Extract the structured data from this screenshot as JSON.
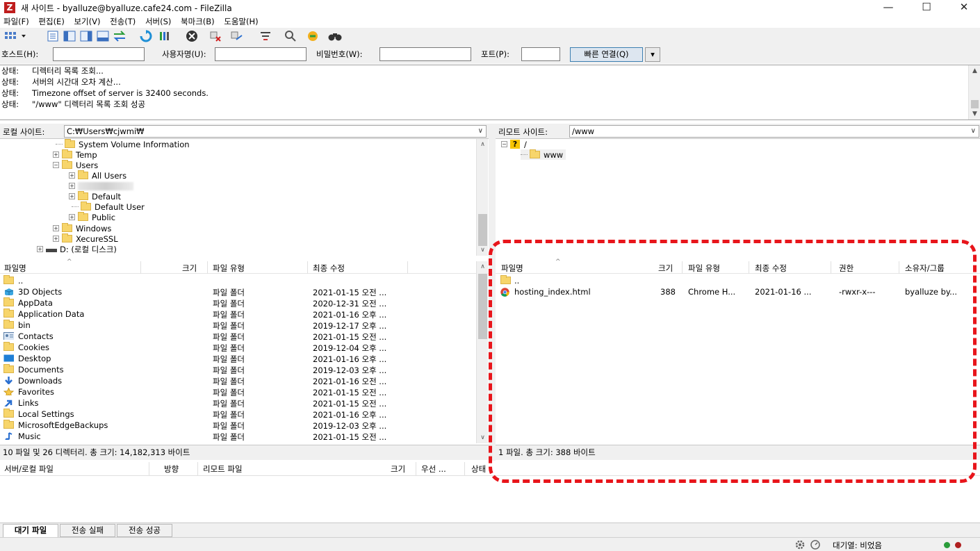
{
  "window": {
    "title": "새 사이트 - byalluze@byalluze.cafe24.com - FileZilla",
    "app_icon_letter": "Z",
    "controls": [
      "—",
      "☐",
      "✕"
    ]
  },
  "menu": [
    "파일(F)",
    "편집(E)",
    "보기(V)",
    "전송(T)",
    "서버(S)",
    "북마크(B)",
    "도움말(H)"
  ],
  "quickconnect": {
    "host_label": "호스트(H):",
    "host_value": "",
    "user_label": "사용자명(U):",
    "user_value": "",
    "pass_label": "비밀번호(W):",
    "pass_value": "",
    "port_label": "포트(P):",
    "port_value": "",
    "connect_label": "빠른 연결(Q)"
  },
  "log": [
    {
      "k": "상태:",
      "v": "디렉터리 목록 조회..."
    },
    {
      "k": "상태:",
      "v": "서버의 시간대 오차 계산..."
    },
    {
      "k": "상태:",
      "v": "Timezone offset of server is 32400 seconds."
    },
    {
      "k": "상태:",
      "v": "\"/www\" 디렉터리 목록 조회 성공"
    }
  ],
  "local": {
    "site_label": "로컬 사이트:",
    "path": "C:₩Users₩cjwmi₩",
    "tree": [
      {
        "label": "System Volume Information",
        "expander": ""
      },
      {
        "label": "Temp",
        "expander": "+"
      },
      {
        "label": "Users",
        "expander": "−"
      },
      {
        "label": "All Users",
        "expander": "+"
      },
      {
        "label": "",
        "expander": "+"
      },
      {
        "label": "Default",
        "expander": "+"
      },
      {
        "label": "Default User",
        "expander": ""
      },
      {
        "label": "Public",
        "expander": "+"
      },
      {
        "label": "Windows",
        "expander": "+"
      },
      {
        "label": "XecureSSL",
        "expander": "+"
      },
      {
        "label": "D: (로컬 디스크)",
        "expander": "+"
      }
    ],
    "columns": [
      "파일명",
      "크기",
      "파일 유형",
      "최종 수정"
    ],
    "files": [
      {
        "name": "..",
        "type": "",
        "modified": "",
        "icon": "folder"
      },
      {
        "name": "3D Objects",
        "type": "파일 폴더",
        "modified": "2021-01-15 오전 ...",
        "icon": "3d-objects"
      },
      {
        "name": "AppData",
        "type": "파일 폴더",
        "modified": "2020-12-31 오전 ...",
        "icon": "folder"
      },
      {
        "name": "Application Data",
        "type": "파일 폴더",
        "modified": "2021-01-16 오후 ...",
        "icon": "folder"
      },
      {
        "name": "bin",
        "type": "파일 폴더",
        "modified": "2019-12-17 오후 ...",
        "icon": "folder"
      },
      {
        "name": "Contacts",
        "type": "파일 폴더",
        "modified": "2021-01-15 오전 ...",
        "icon": "contacts"
      },
      {
        "name": "Cookies",
        "type": "파일 폴더",
        "modified": "2019-12-04 오후 ...",
        "icon": "folder"
      },
      {
        "name": "Desktop",
        "type": "파일 폴더",
        "modified": "2021-01-16 오후 ...",
        "icon": "desktop"
      },
      {
        "name": "Documents",
        "type": "파일 폴더",
        "modified": "2019-12-03 오후 ...",
        "icon": "folder"
      },
      {
        "name": "Downloads",
        "type": "파일 폴더",
        "modified": "2021-01-16 오전 ...",
        "icon": "downloads"
      },
      {
        "name": "Favorites",
        "type": "파일 폴더",
        "modified": "2021-01-15 오전 ...",
        "icon": "star"
      },
      {
        "name": "Links",
        "type": "파일 폴더",
        "modified": "2021-01-15 오전 ...",
        "icon": "links"
      },
      {
        "name": "Local Settings",
        "type": "파일 폴더",
        "modified": "2021-01-16 오후 ...",
        "icon": "folder"
      },
      {
        "name": "MicrosoftEdgeBackups",
        "type": "파일 폴더",
        "modified": "2019-12-03 오후 ...",
        "icon": "folder"
      },
      {
        "name": "Music",
        "type": "파일 폴더",
        "modified": "2021-01-15 오전 ...",
        "icon": "music"
      }
    ],
    "status": "10 파일 및 26 디렉터리. 총 크기: 14,182,313 바이트"
  },
  "remote": {
    "site_label": "리모트 사이트:",
    "path": "/www",
    "tree": [
      {
        "label": "/",
        "icon": "question"
      },
      {
        "label": "www",
        "icon": "folder"
      }
    ],
    "columns": [
      "파일명",
      "크기",
      "파일 유형",
      "최종 수정",
      "권한",
      "소유자/그룹"
    ],
    "files": [
      {
        "name": "..",
        "size": "",
        "type": "",
        "modified": "",
        "perm": "",
        "owner": "",
        "icon": "folder"
      },
      {
        "name": "hosting_index.html",
        "size": "388",
        "type": "Chrome H...",
        "modified": "2021-01-16 ...",
        "perm": "-rwxr-x---",
        "owner": "byalluze by...",
        "icon": "chrome"
      }
    ],
    "status": "1 파일. 총 크기: 388 바이트"
  },
  "queue": {
    "columns": [
      "서버/로컬 파일",
      "방향",
      "리모트 파일",
      "크기",
      "우선 ...",
      "상태"
    ],
    "tabs": [
      "대기 파일",
      "전송 실패",
      "전송 성공"
    ],
    "status_text": "대기열: 비었음"
  },
  "colors": {
    "highlight": "#e8151b",
    "folder": "#f7d56b"
  }
}
